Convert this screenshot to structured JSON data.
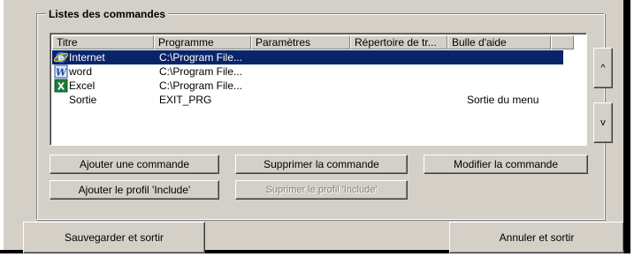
{
  "group": {
    "title": "Listes des commandes"
  },
  "list": {
    "columns": [
      "Titre",
      "Programme",
      "Paramètres",
      "Répertoire de tr...",
      "Bulle d'aide"
    ],
    "rows": [
      {
        "titre": "Internet",
        "programme": "C:\\Program File...",
        "parametres": "",
        "repertoire": "",
        "bulle": "",
        "icon": "internet-explorer-icon",
        "selected": true
      },
      {
        "titre": "word",
        "programme": "C:\\Program File...",
        "parametres": "",
        "repertoire": "",
        "bulle": "",
        "icon": "word-icon",
        "selected": false
      },
      {
        "titre": "Excel",
        "programme": "C:\\Program File...",
        "parametres": "",
        "repertoire": "",
        "bulle": "",
        "icon": "excel-icon",
        "selected": false
      },
      {
        "titre": "Sortie",
        "programme": "EXIT_PRG",
        "parametres": "",
        "repertoire": "",
        "bulle": "Sortie du menu",
        "icon": "",
        "selected": false
      }
    ]
  },
  "side": {
    "up_label": "^",
    "down_label": "v"
  },
  "buttons": {
    "add": "Ajouter une commande",
    "delete": "Supprimer la commande",
    "modify": "Modifier la commande",
    "add_profile": "Ajouter le profil 'Include'",
    "delete_profile": "Suprimer le profil 'Include'",
    "save_exit": "Sauvegarder et sortir",
    "cancel_exit": "Annuler et sortir"
  },
  "colors": {
    "face": "#d4d0c8",
    "selection": "#0a246a"
  }
}
